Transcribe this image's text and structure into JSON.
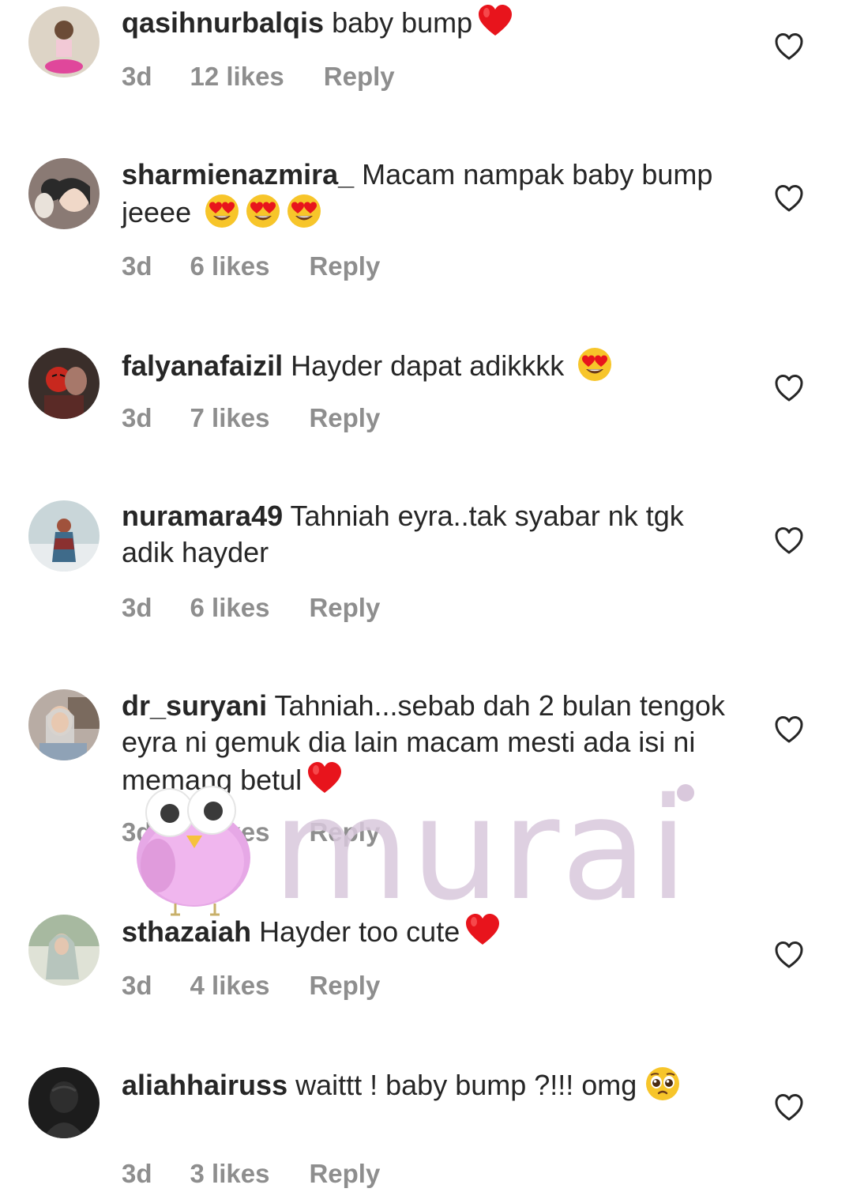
{
  "comments": [
    {
      "username": "qasihnurbalqis",
      "text": "baby bump",
      "emojis": [
        "red-heart"
      ],
      "time": "3d",
      "likes": "12 likes",
      "reply": "Reply"
    },
    {
      "username": "sharmienazmira_",
      "text": "Macam nampak baby bump jeeee",
      "emojis": [
        "heart-eyes",
        "heart-eyes",
        "heart-eyes"
      ],
      "time": "3d",
      "likes": "6 likes",
      "reply": "Reply"
    },
    {
      "username": "falyanafaizil",
      "text": "Hayder dapat adikkkk",
      "emojis": [
        "heart-eyes"
      ],
      "time": "3d",
      "likes": "7 likes",
      "reply": "Reply"
    },
    {
      "username": "nuramara49",
      "text": "Tahniah eyra..tak syabar nk tgk adik hayder",
      "emojis": [],
      "time": "3d",
      "likes": "6 likes",
      "reply": "Reply"
    },
    {
      "username": "dr_suryani",
      "text": "Tahniah...sebab dah 2 bulan tengok eyra ni gemuk dia lain macam mesti ada isi ni memang betul",
      "emojis": [
        "red-heart"
      ],
      "time": "3d",
      "likes": "4 likes",
      "reply": "Reply"
    },
    {
      "username": "sthazaiah",
      "text": "Hayder too cute",
      "emojis": [
        "red-heart"
      ],
      "time": "3d",
      "likes": "4 likes",
      "reply": "Reply"
    },
    {
      "username": "aliahhairuss",
      "text": "waittt ! baby bump ?!!! omg",
      "emojis": [
        "pleading-face"
      ],
      "time": "3d",
      "likes": "3 likes",
      "reply": "Reply"
    }
  ],
  "watermark": {
    "text": "murai",
    "color": "#d9c8dc"
  },
  "colors": {
    "text": "#262626",
    "meta": "#8e8e8e",
    "emoji_heart": "#e8141c",
    "emoji_face": "#f7c52a"
  },
  "icons": {
    "like": "heart-outline-icon"
  }
}
